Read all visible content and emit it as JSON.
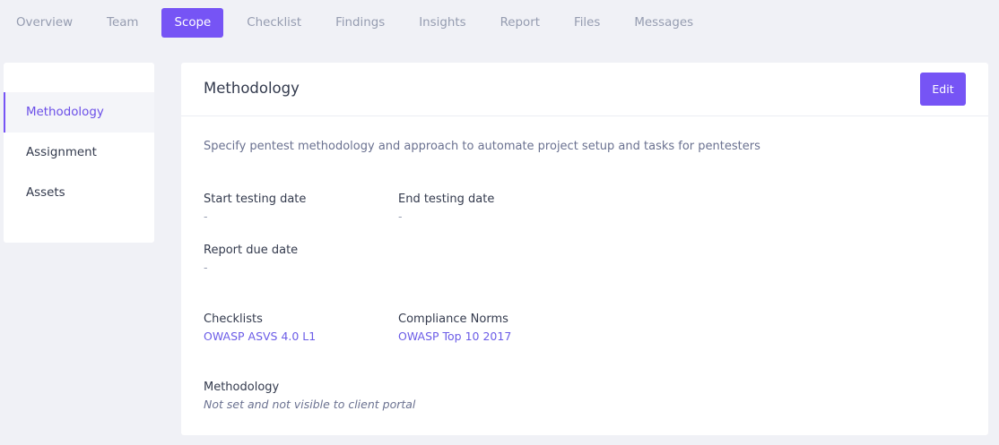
{
  "tabs": [
    {
      "label": "Overview"
    },
    {
      "label": "Team"
    },
    {
      "label": "Scope",
      "active": true
    },
    {
      "label": "Checklist"
    },
    {
      "label": "Findings"
    },
    {
      "label": "Insights"
    },
    {
      "label": "Report"
    },
    {
      "label": "Files"
    },
    {
      "label": "Messages"
    }
  ],
  "sidebar": {
    "items": [
      {
        "label": "Methodology",
        "active": true
      },
      {
        "label": "Assignment"
      },
      {
        "label": "Assets"
      }
    ]
  },
  "card": {
    "title": "Methodology",
    "edit_label": "Edit",
    "description": "Specify pentest methodology and approach to automate project setup and tasks for pentesters",
    "fields": {
      "start_date": {
        "label": "Start testing date",
        "value": "-"
      },
      "end_date": {
        "label": "End testing date",
        "value": "-"
      },
      "report_due": {
        "label": "Report due date",
        "value": "-"
      },
      "checklists": {
        "label": "Checklists",
        "value": "OWASP ASVS 4.0 L1"
      },
      "compliance": {
        "label": "Compliance Norms",
        "value": "OWASP Top 10 2017"
      },
      "methodology": {
        "label": "Methodology",
        "value": "Not set and not visible to client portal"
      }
    }
  },
  "colors": {
    "accent": "#7654f5",
    "background": "#f0f1f6",
    "link": "#6b5ce7"
  }
}
